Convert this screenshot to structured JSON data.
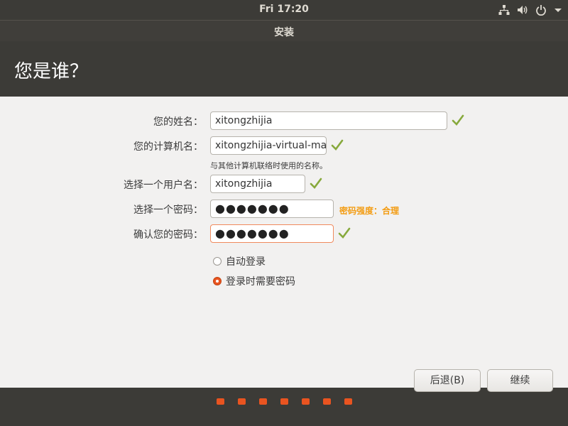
{
  "topbar": {
    "clock": "Fri 17:20"
  },
  "window": {
    "title": "安装",
    "heading": "您是谁？",
    "form": {
      "name_label": "您的姓名：",
      "name_value": "xitongzhijia",
      "computer_label": "您的计算机名：",
      "computer_value": "xitongzhijia-virtual-ma",
      "computer_hint": "与其他计算机联络时使用的名称。",
      "username_label": "选择一个用户名：",
      "username_value": "xitongzhijia",
      "password_label": "选择一个密码：",
      "password_value": "●●●●●●●",
      "password_strength": "密码强度：合理",
      "confirm_label": "确认您的密码：",
      "confirm_value": "●●●●●●●",
      "auto_login_label": "自动登录",
      "require_password_label": "登录时需要密码",
      "selected_option": "登录时需要密码"
    },
    "buttons": {
      "back": "后退(B)",
      "continue": "继续"
    }
  },
  "progress": {
    "total_steps": 7
  },
  "colors": {
    "accent": "#e95420",
    "check": "#87a93c",
    "strength": "#f39c12"
  }
}
